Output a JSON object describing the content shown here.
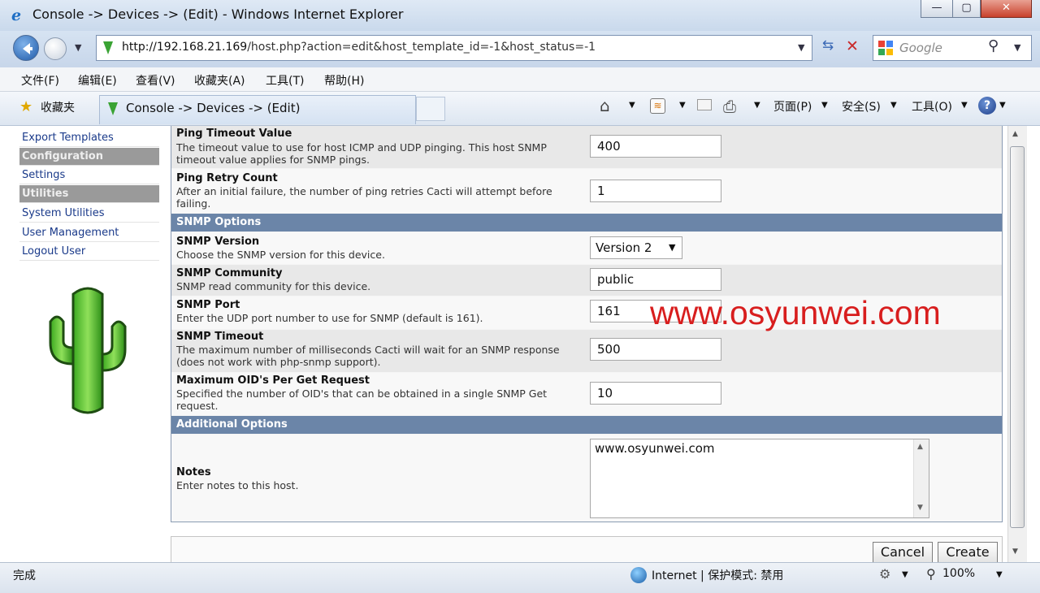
{
  "window": {
    "title": "Console -> Devices -> (Edit) - Windows Internet Explorer",
    "minimize": "—",
    "maximize": "▢",
    "close": "✕"
  },
  "address": {
    "url_host": "http://192.168.21.169",
    "url_path": "/host.php?action=edit&host_template_id=-1&host_status=-1",
    "search_placeholder": "Google"
  },
  "menu": [
    "文件(F)",
    "编辑(E)",
    "查看(V)",
    "收藏夹(A)",
    "工具(T)",
    "帮助(H)"
  ],
  "favbar": {
    "favorites": "收藏夹",
    "tab_title": "Console -> Devices -> (Edit)",
    "page_menu": "页面(P)",
    "safety_menu": "安全(S)",
    "tools_menu": "工具(O)"
  },
  "sidebar": {
    "items": [
      {
        "label": "Export Templates",
        "kind": "link"
      },
      {
        "label": "Configuration",
        "kind": "section"
      },
      {
        "label": "Settings",
        "kind": "link"
      },
      {
        "label": "Utilities",
        "kind": "section"
      },
      {
        "label": "System Utilities",
        "kind": "link"
      },
      {
        "label": "User Management",
        "kind": "link"
      },
      {
        "label": "Logout User",
        "kind": "link"
      }
    ]
  },
  "form": {
    "ping_timeout": {
      "label": "Ping Timeout Value",
      "desc": "The timeout value to use for host ICMP and UDP pinging. This host SNMP timeout value applies for SNMP pings.",
      "value": "400"
    },
    "ping_retry": {
      "label": "Ping Retry Count",
      "desc": "After an initial failure, the number of ping retries Cacti will attempt before failing.",
      "value": "1"
    },
    "snmp_header": "SNMP Options",
    "snmp_version": {
      "label": "SNMP Version",
      "desc": "Choose the SNMP version for this device.",
      "value": "Version 2"
    },
    "snmp_community": {
      "label": "SNMP Community",
      "desc": "SNMP read community for this device.",
      "value": "public"
    },
    "snmp_port": {
      "label": "SNMP Port",
      "desc": "Enter the UDP port number to use for SNMP (default is 161).",
      "value": "161"
    },
    "snmp_timeout": {
      "label": "SNMP Timeout",
      "desc": "The maximum number of milliseconds Cacti will wait for an SNMP response (does not work with php-snmp support).",
      "value": "500"
    },
    "max_oids": {
      "label": "Maximum OID's Per Get Request",
      "desc": "Specified the number of OID's that can be obtained in a single SNMP Get request.",
      "value": "10"
    },
    "additional_header": "Additional Options",
    "notes": {
      "label": "Notes",
      "desc": "Enter notes to this host.",
      "value": "www.osyunwei.com"
    },
    "cancel": "Cancel",
    "create": "Create"
  },
  "watermark": "www.osyunwei.com",
  "status": {
    "left": "完成",
    "zone": "Internet | 保护模式: 禁用",
    "zoom": "100%"
  },
  "colors": {
    "header_blue": "#6b85a8",
    "section_gray": "#9a9a9a",
    "watermark_red": "#d81e1e"
  }
}
